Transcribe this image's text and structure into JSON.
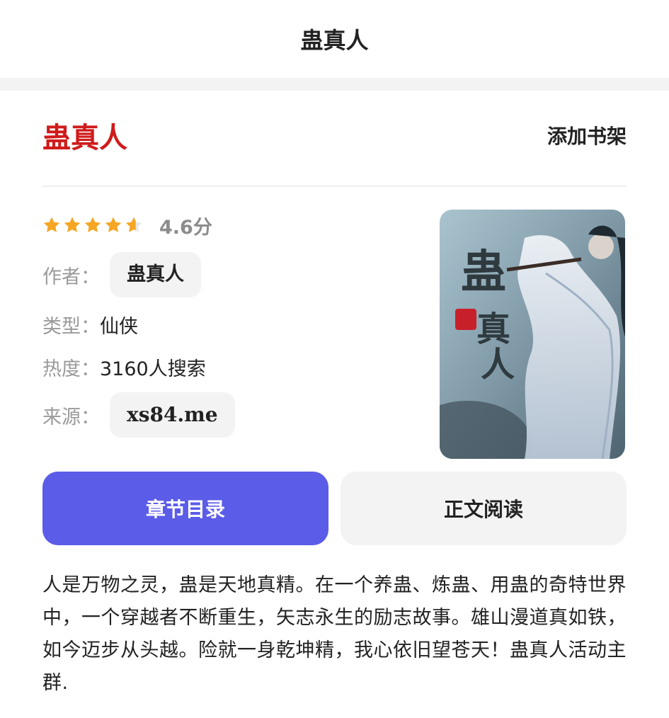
{
  "header": {
    "title": "蛊真人"
  },
  "book": {
    "title": "蛊真人",
    "add_shelf_label": "添加书架",
    "rating": {
      "score": 4.6,
      "max": 5,
      "text": "4.6分",
      "star_color": "#f5a623"
    },
    "author": {
      "label": "作者：",
      "value": "蛊真人"
    },
    "genre": {
      "label": "类型：",
      "value": "仙侠"
    },
    "heat": {
      "label": "热度：",
      "value": "3160人搜索"
    },
    "source": {
      "label": "来源：",
      "value": "xs84.me"
    },
    "cover": {
      "alt": "book-cover"
    }
  },
  "actions": {
    "toc_label": "章节目录",
    "read_label": "正文阅读",
    "primary_color": "#5b5ce8"
  },
  "description": "人是万物之灵，蛊是天地真精。在一个养蛊、炼蛊、用蛊的奇特世界中，一个穿越者不断重生，矢志永生的励志故事。雄山漫道真如铁，如今迈步从头越。险就一身乾坤精，我心依旧望苍天！蛊真人活动主群."
}
